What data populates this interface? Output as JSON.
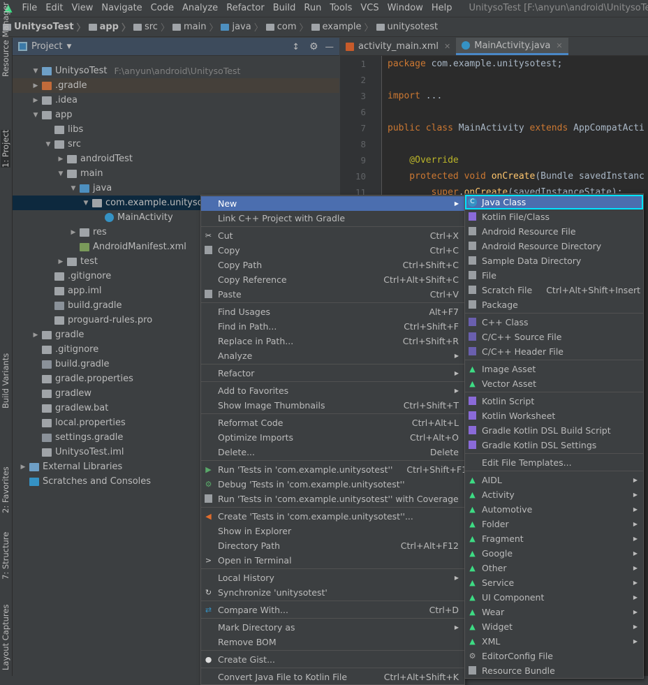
{
  "menubar": {
    "items": [
      "File",
      "Edit",
      "View",
      "Navigate",
      "Code",
      "Analyze",
      "Refactor",
      "Build",
      "Run",
      "Tools",
      "VCS",
      "Window",
      "Help"
    ],
    "title": "UnitysoTest [F:\\anyun\\android\\UnitysoTest] - ...\\app"
  },
  "breadcrumb": [
    "UnitysoTest",
    "app",
    "src",
    "main",
    "java",
    "com",
    "example",
    "unitysotest"
  ],
  "left_strip": [
    "Resource Manager",
    "1: Project",
    "Build Variants",
    "2: Favorites",
    "7: Structure",
    "Layout Captures"
  ],
  "project": {
    "title": "Project",
    "tree": [
      {
        "label": "UnitysoTest",
        "path": "F:\\anyun\\android\\UnitysoTest",
        "depth": 1,
        "arrow": "down",
        "icon": "module-folder-icon",
        "color": "#6e9fc6"
      },
      {
        "label": ".gradle",
        "depth": 1,
        "arrow": "right",
        "icon": "folder-icon",
        "color": "#c26b3a",
        "highlight": true
      },
      {
        "label": ".idea",
        "depth": 1,
        "arrow": "right",
        "icon": "folder-icon",
        "color": "#a0a4a8"
      },
      {
        "label": "app",
        "depth": 1,
        "arrow": "down",
        "icon": "module-folder-icon",
        "color": "#a0a4a8"
      },
      {
        "label": "libs",
        "depth": 2,
        "icon": "folder-icon",
        "color": "#a0a4a8"
      },
      {
        "label": "src",
        "depth": 2,
        "arrow": "down",
        "icon": "folder-icon",
        "color": "#a0a4a8"
      },
      {
        "label": "androidTest",
        "depth": 3,
        "arrow": "right",
        "icon": "folder-icon",
        "color": "#a0a4a8"
      },
      {
        "label": "main",
        "depth": 3,
        "arrow": "down",
        "icon": "folder-icon",
        "color": "#a0a4a8"
      },
      {
        "label": "java",
        "depth": 4,
        "arrow": "down",
        "icon": "source-folder-icon",
        "color": "#4d8fbf"
      },
      {
        "label": "com.example.unitysotest",
        "depth": 5,
        "arrow": "down",
        "icon": "package-icon",
        "color": "#a0a4a8",
        "selected": true
      },
      {
        "label": "MainActivity",
        "depth": 6,
        "icon": "java-class-icon",
        "color": "#3592c4"
      },
      {
        "label": "res",
        "depth": 4,
        "arrow": "right",
        "icon": "resource-folder-icon",
        "color": "#a0a4a8"
      },
      {
        "label": "AndroidManifest.xml",
        "depth": 4,
        "icon": "manifest-icon",
        "color": "#7a9a5a"
      },
      {
        "label": "test",
        "depth": 3,
        "arrow": "right",
        "icon": "folder-icon",
        "color": "#a0a4a8"
      },
      {
        "label": ".gitignore",
        "depth": 2,
        "icon": "file-icon",
        "color": "#a0a4a8"
      },
      {
        "label": "app.iml",
        "depth": 2,
        "icon": "iml-icon",
        "color": "#a0a4a8"
      },
      {
        "label": "build.gradle",
        "depth": 2,
        "icon": "gradle-icon",
        "color": "#8a9199"
      },
      {
        "label": "proguard-rules.pro",
        "depth": 2,
        "icon": "file-icon",
        "color": "#a0a4a8"
      },
      {
        "label": "gradle",
        "depth": 1,
        "arrow": "right",
        "icon": "folder-icon",
        "color": "#a0a4a8"
      },
      {
        "label": ".gitignore",
        "depth": 1,
        "icon": "file-icon",
        "color": "#a0a4a8"
      },
      {
        "label": "build.gradle",
        "depth": 1,
        "icon": "gradle-icon",
        "color": "#8a9199"
      },
      {
        "label": "gradle.properties",
        "depth": 1,
        "icon": "properties-icon",
        "color": "#a0a4a8"
      },
      {
        "label": "gradlew",
        "depth": 1,
        "icon": "terminal-file-icon",
        "color": "#a0a4a8"
      },
      {
        "label": "gradlew.bat",
        "depth": 1,
        "icon": "file-icon",
        "color": "#a0a4a8"
      },
      {
        "label": "local.properties",
        "depth": 1,
        "icon": "properties-icon",
        "color": "#a0a4a8"
      },
      {
        "label": "settings.gradle",
        "depth": 1,
        "icon": "gradle-icon",
        "color": "#8a9199"
      },
      {
        "label": "UnitysoTest.iml",
        "depth": 1,
        "icon": "iml-icon",
        "color": "#a0a4a8"
      },
      {
        "label": "External Libraries",
        "depth": 0,
        "arrow": "right",
        "icon": "libraries-icon",
        "color": "#6e9fc6"
      },
      {
        "label": "Scratches and Consoles",
        "depth": 0,
        "icon": "scratches-icon",
        "color": "#3592c4"
      }
    ]
  },
  "editor": {
    "tabs": [
      {
        "label": "activity_main.xml",
        "icon": "xml-layout-icon"
      },
      {
        "label": "MainActivity.java",
        "icon": "java-class-icon",
        "active": true
      }
    ],
    "lines": [
      "1",
      "2",
      "3",
      "6",
      "7",
      "8",
      "9",
      "10",
      "11"
    ],
    "code": [
      [
        [
          "kw",
          "package "
        ],
        [
          "",
          "com.example.unitysotest;"
        ]
      ],
      [],
      [
        [
          "kw",
          "import "
        ],
        [
          "",
          "..."
        ]
      ],
      [],
      [
        [
          "kw",
          "public class "
        ],
        [
          "",
          "MainActivity "
        ],
        [
          "kw",
          "extends "
        ],
        [
          "",
          "AppCompatActi"
        ]
      ],
      [],
      [
        [
          "an",
          "    @Override"
        ]
      ],
      [
        [
          "kw",
          "    protected void "
        ],
        [
          "fn",
          "onCreate"
        ],
        [
          "",
          "(Bundle savedInstanc"
        ]
      ],
      [
        [
          "kw",
          "        super"
        ],
        [
          "",
          "."
        ],
        [
          "fn",
          "onCreate"
        ],
        [
          "",
          "(savedInstanceState);"
        ]
      ]
    ]
  },
  "context_menu": [
    {
      "label": "New",
      "submenu": true,
      "selected": true
    },
    {
      "label": "Link C++ Project with Gradle",
      "sep": true
    },
    {
      "label": "Cut",
      "shortcut": "Ctrl+X",
      "icon": "scissors-icon"
    },
    {
      "label": "Copy",
      "shortcut": "Ctrl+C",
      "icon": "copy-icon"
    },
    {
      "label": "Copy Path",
      "shortcut": "Ctrl+Shift+C"
    },
    {
      "label": "Copy Reference",
      "shortcut": "Ctrl+Alt+Shift+C"
    },
    {
      "label": "Paste",
      "shortcut": "Ctrl+V",
      "icon": "paste-icon",
      "sep": true
    },
    {
      "label": "Find Usages",
      "shortcut": "Alt+F7"
    },
    {
      "label": "Find in Path...",
      "shortcut": "Ctrl+Shift+F"
    },
    {
      "label": "Replace in Path...",
      "shortcut": "Ctrl+Shift+R"
    },
    {
      "label": "Analyze",
      "submenu": true,
      "sep": true
    },
    {
      "label": "Refactor",
      "submenu": true,
      "sep": true
    },
    {
      "label": "Add to Favorites",
      "submenu": true
    },
    {
      "label": "Show Image Thumbnails",
      "shortcut": "Ctrl+Shift+T",
      "sep": true
    },
    {
      "label": "Reformat Code",
      "shortcut": "Ctrl+Alt+L"
    },
    {
      "label": "Optimize Imports",
      "shortcut": "Ctrl+Alt+O"
    },
    {
      "label": "Delete...",
      "shortcut": "Delete",
      "sep": true
    },
    {
      "label": "Run 'Tests in 'com.example.unitysotest''",
      "shortcut": "Ctrl+Shift+F10",
      "icon": "run-icon"
    },
    {
      "label": "Debug 'Tests in 'com.example.unitysotest''",
      "icon": "debug-icon"
    },
    {
      "label": "Run 'Tests in 'com.example.unitysotest'' with Coverage",
      "icon": "coverage-icon",
      "sep": true
    },
    {
      "label": "Create 'Tests in 'com.example.unitysotest''...",
      "icon": "create-config-icon"
    },
    {
      "label": "Show in Explorer"
    },
    {
      "label": "Directory Path",
      "shortcut": "Ctrl+Alt+F12"
    },
    {
      "label": "Open in Terminal",
      "icon": "terminal-icon",
      "sep": true
    },
    {
      "label": "Local History",
      "submenu": true
    },
    {
      "label": "Synchronize 'unitysotest'",
      "icon": "sync-icon",
      "sep": true
    },
    {
      "label": "Compare With...",
      "shortcut": "Ctrl+D",
      "icon": "compare-icon",
      "sep": true
    },
    {
      "label": "Mark Directory as",
      "submenu": true
    },
    {
      "label": "Remove BOM",
      "sep": true
    },
    {
      "label": "Create Gist...",
      "icon": "github-icon",
      "sep": true
    },
    {
      "label": "Convert Java File to Kotlin File",
      "shortcut": "Ctrl+Alt+Shift+K"
    }
  ],
  "new_submenu": [
    {
      "label": "Java Class",
      "icon": "java-class-icon",
      "selected": true,
      "focused": true
    },
    {
      "label": "Kotlin File/Class",
      "icon": "kotlin-file-icon"
    },
    {
      "label": "Android Resource File",
      "icon": "android-resource-file-icon"
    },
    {
      "label": "Android Resource Directory",
      "icon": "folder-icon"
    },
    {
      "label": "Sample Data Directory",
      "icon": "folder-icon"
    },
    {
      "label": "File",
      "icon": "file-icon"
    },
    {
      "label": "Scratch File",
      "shortcut": "Ctrl+Alt+Shift+Insert",
      "icon": "scratch-file-icon"
    },
    {
      "label": "Package",
      "icon": "package-icon",
      "sep": true
    },
    {
      "label": "C++ Class",
      "icon": "cpp-class-icon"
    },
    {
      "label": "C/C++ Source File",
      "icon": "cpp-source-icon"
    },
    {
      "label": "C/C++ Header File",
      "icon": "cpp-header-icon",
      "sep": true
    },
    {
      "label": "Image Asset",
      "icon": "android-icon"
    },
    {
      "label": "Vector Asset",
      "icon": "android-icon",
      "sep": true
    },
    {
      "label": "Kotlin Script",
      "icon": "kotlin-script-icon"
    },
    {
      "label": "Kotlin Worksheet",
      "icon": "kotlin-worksheet-icon"
    },
    {
      "label": "Gradle Kotlin DSL Build Script",
      "icon": "gradle-kotlin-icon"
    },
    {
      "label": "Gradle Kotlin DSL Settings",
      "icon": "gradle-kotlin-icon",
      "sep": true
    },
    {
      "label": "Edit File Templates...",
      "sep": true
    },
    {
      "label": "AIDL",
      "icon": "android-icon",
      "submenu": true
    },
    {
      "label": "Activity",
      "icon": "android-icon",
      "submenu": true
    },
    {
      "label": "Automotive",
      "icon": "android-icon",
      "submenu": true
    },
    {
      "label": "Folder",
      "icon": "android-icon",
      "submenu": true
    },
    {
      "label": "Fragment",
      "icon": "android-icon",
      "submenu": true
    },
    {
      "label": "Google",
      "icon": "android-icon",
      "submenu": true
    },
    {
      "label": "Other",
      "icon": "android-icon",
      "submenu": true
    },
    {
      "label": "Service",
      "icon": "android-icon",
      "submenu": true
    },
    {
      "label": "UI Component",
      "icon": "android-icon",
      "submenu": true
    },
    {
      "label": "Wear",
      "icon": "android-icon",
      "submenu": true
    },
    {
      "label": "Widget",
      "icon": "android-icon",
      "submenu": true
    },
    {
      "label": "XML",
      "icon": "android-icon",
      "submenu": true
    },
    {
      "label": "EditorConfig File",
      "icon": "gear-icon"
    },
    {
      "label": "Resource Bundle",
      "icon": "resource-bundle-icon"
    }
  ],
  "colors": {
    "selection": "#4b6eaf",
    "focus_outline": "#00e5ff",
    "android_green": "#3ddc84"
  }
}
